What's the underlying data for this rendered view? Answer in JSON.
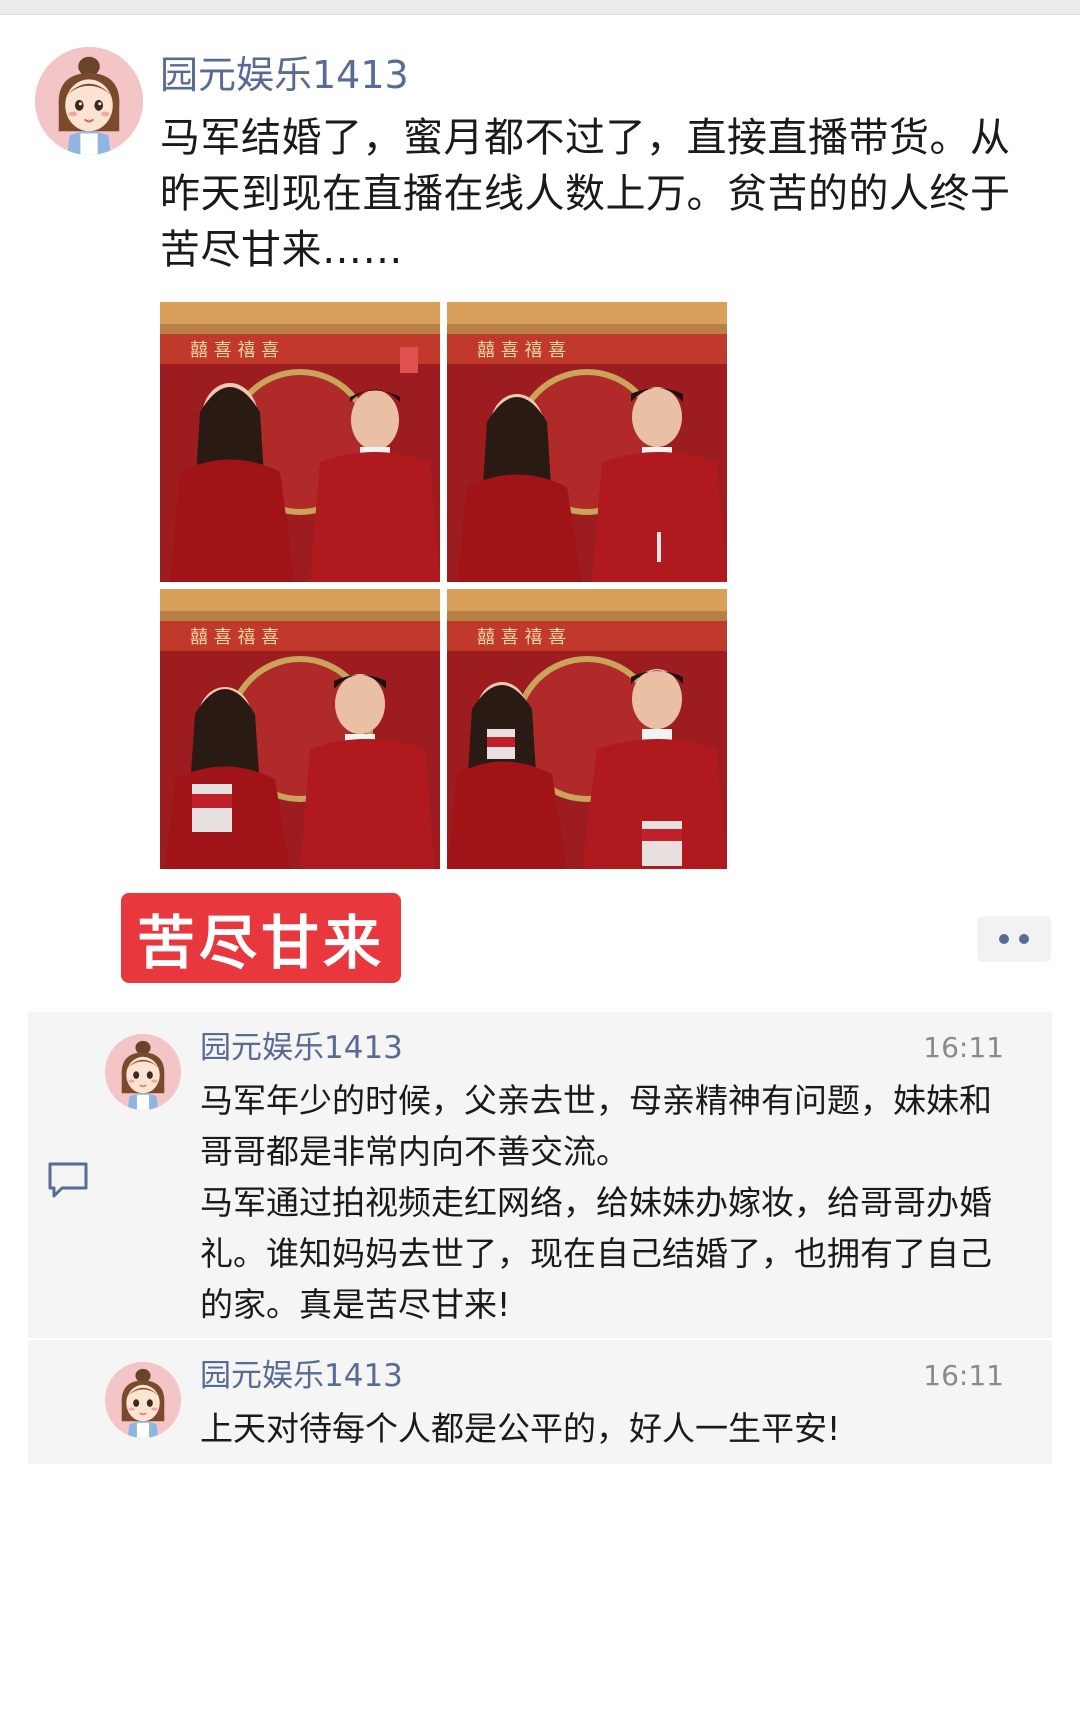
{
  "post": {
    "author": "园元娱乐1413",
    "text": "马军结婚了，蜜月都不过了，直接直播带货。从昨天到现在直播在线人数上万。贫苦的的人终于苦尽甘来……",
    "photos": [
      {
        "description_icon": "couple-photo"
      },
      {
        "description_icon": "couple-photo"
      },
      {
        "description_icon": "couple-photo"
      },
      {
        "description_icon": "couple-photo"
      }
    ],
    "tag": "苦尽甘来"
  },
  "comments": [
    {
      "author": "园元娱乐1413",
      "time": "16:11",
      "text": "马军年少的时候，父亲去世，母亲精神有问题，妹妹和哥哥都是非常内向不善交流。\n马军通过拍视频走红网络，给妹妹办嫁妆，给哥哥办婚礼。谁知妈妈去世了，现在自己结婚了，也拥有了自己的家。真是苦尽甘来!"
    },
    {
      "author": "园元娱乐1413",
      "time": "16:11",
      "text": "上天对待每个人都是公平的，好人一生平安!"
    }
  ],
  "colors": {
    "name_link": "#576b95",
    "tag_red": "#e8383d",
    "panel_bg": "#f5f5f5"
  },
  "icons": {
    "more": "more-dots-icon",
    "comment": "comment-bubble-icon",
    "avatar": "cartoon-girl-avatar"
  }
}
